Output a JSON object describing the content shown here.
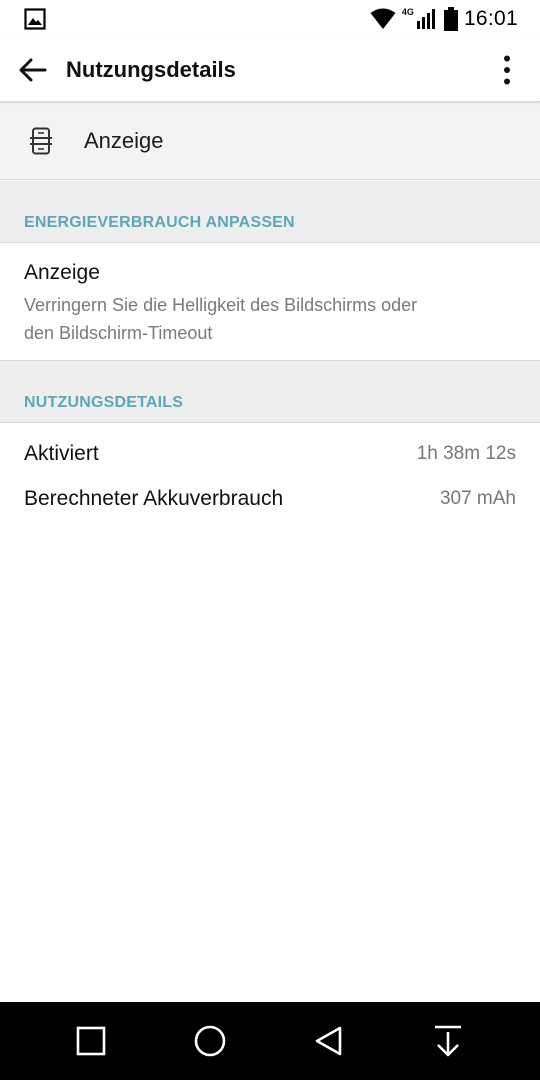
{
  "status_bar": {
    "time": "16:01",
    "network": "4G",
    "icons": [
      "image-icon",
      "wifi-icon",
      "signal-icon",
      "battery-icon"
    ]
  },
  "app_bar": {
    "title": "Nutzungsdetails",
    "back_icon": "arrow-back-icon",
    "menu_icon": "more-vert-icon"
  },
  "app": {
    "name": "Anzeige",
    "icon": "display-icon"
  },
  "sections": {
    "adjust": {
      "header": "ENERGIEVERBRAUCH ANPASSEN",
      "item_title": "Anzeige",
      "item_desc_line1": "Verringern Sie die Helligkeit des Bildschirms oder",
      "item_desc_line2": "den Bildschirm-Timeout"
    },
    "details": {
      "header": "NUTZUNGSDETAILS",
      "rows": [
        {
          "label": "Aktiviert",
          "value": "1h 38m 12s"
        },
        {
          "label": "Berechneter Akkuverbrauch",
          "value": "307 mAh"
        }
      ]
    }
  },
  "nav_bar": {
    "icons": [
      "recents-icon",
      "home-icon",
      "back-icon",
      "notification-pull-icon"
    ]
  },
  "colors": {
    "section_header_text": "#5aa8b8",
    "section_bg": "#eeeeee",
    "nav_bg": "#000000"
  }
}
